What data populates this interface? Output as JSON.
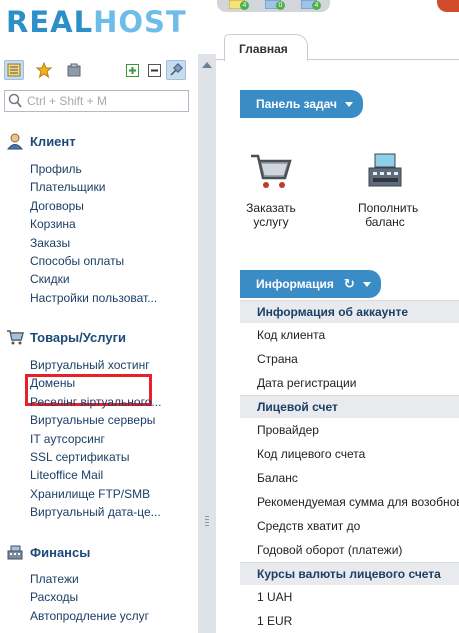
{
  "logo": {
    "part1": "REAL",
    "part2": "HOST"
  },
  "top_badges": [
    "4",
    "0",
    "4"
  ],
  "sidebar": {
    "search_placeholder": "Ctrl + Shift + M",
    "sections": [
      {
        "title": "Клиент",
        "icon": "user-icon",
        "items": [
          "Профиль",
          "Плательщики",
          "Договоры",
          "Корзина",
          "Заказы",
          "Способы оплаты",
          "Скидки",
          "Настройки пользоват..."
        ]
      },
      {
        "title": "Товары/Услуги",
        "icon": "cart-icon",
        "items": [
          "Виртуальный хостинг",
          "Домены",
          "Реселінг віртуального...",
          "Виртуальные серверы",
          "IT аутсорсинг",
          "SSL сертификаты",
          "Liteoffice Mail",
          "Хранилище FTP/SMB",
          "Виртуальный дата-це..."
        ]
      },
      {
        "title": "Финансы",
        "icon": "cash-register-icon",
        "items": [
          "Платежи",
          "Расходы",
          "Автопродление услуг"
        ]
      }
    ]
  },
  "main": {
    "tab_label": "Главная",
    "tasks_panel": {
      "title": "Панель задач",
      "tasks": [
        {
          "label": "Заказать услугу",
          "icon": "shopping-cart-icon"
        },
        {
          "label": "Пополнить баланс",
          "icon": "cash-register-icon"
        }
      ]
    },
    "info_panel": {
      "title": "Информация",
      "groups": [
        {
          "title": "Информация об аккаунте",
          "rows": [
            "Код клиента",
            "Страна",
            "Дата регистрации"
          ]
        },
        {
          "title": "Лицевой счет",
          "rows": [
            "Провайдер",
            "Код лицевого счета",
            "Баланс",
            "Рекомендуемая сумма для возобнов",
            "Средств хватит до",
            "Годовой оборот (платежи)"
          ]
        },
        {
          "title": "Курсы валюты лицевого счета",
          "rows": [
            "1 UAH",
            "1 EUR"
          ]
        }
      ]
    }
  },
  "colors": {
    "accent": "#3a8cc6",
    "highlight": "#e8202a",
    "nav_text": "#1b3f66"
  }
}
